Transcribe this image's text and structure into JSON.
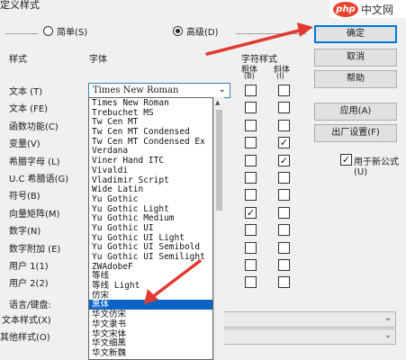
{
  "window": {
    "title": "定义样式"
  },
  "mode": {
    "simple_label": "简单(S)",
    "advanced_label": "高级(D)",
    "selected": "advanced"
  },
  "headers": {
    "style": "样式",
    "font": "字体",
    "char_format": "字符样式",
    "bold": "粗体",
    "bold_key": "(B)",
    "italic": "斜体",
    "italic_key": "(I)"
  },
  "font_select": {
    "value": "Times New Roman"
  },
  "rows": [
    {
      "label": "文本 (T)",
      "bold": false,
      "italic": false
    },
    {
      "label": "文本 (FE)",
      "bold": false,
      "italic": false
    },
    {
      "label": "函数功能(C)",
      "bold": false,
      "italic": false
    },
    {
      "label": "变量(V)",
      "bold": false,
      "italic": true
    },
    {
      "label": "希腊字母 (L)",
      "bold": false,
      "italic": true
    },
    {
      "label": "U.C 希腊语(G)",
      "bold": false,
      "italic": false
    },
    {
      "label": "符号(B)",
      "bold": false,
      "italic": false
    },
    {
      "label": "向量矩阵(M)",
      "bold": true,
      "italic": false
    },
    {
      "label": "数字(N)",
      "bold": false,
      "italic": false
    },
    {
      "label": "数字附加 (E)",
      "bold": false,
      "italic": false
    },
    {
      "label": "用户 1(1)",
      "bold": false,
      "italic": false
    },
    {
      "label": "用户 2(2)",
      "bold": false,
      "italic": false
    }
  ],
  "font_options": [
    "Times New Roman",
    "Trebuchet MS",
    "Tw Cen MT",
    "Tw Cen MT Condensed",
    "Tw Cen MT Condensed Ex",
    "Verdana",
    "Viner Hand ITC",
    "Vivaldi",
    "Vladimir Script",
    "Wide Latin",
    "Yu Gothic",
    "Yu Gothic Light",
    "Yu Gothic Medium",
    "Yu Gothic UI",
    "Yu Gothic UI Light",
    "Yu Gothic UI Semibold",
    "Yu Gothic UI Semilight",
    "ZWAdobeF",
    "等线",
    "等线 Light",
    "仿宋",
    "黑体",
    "华文仿宋",
    "华文隶书",
    "华文宋体",
    "华文细黑",
    "华文新魏"
  ],
  "selected_option_index": 21,
  "buttons": {
    "ok": "确定",
    "cancel": "取消",
    "help": "帮助",
    "apply": "应用(A)",
    "factory": "出厂设置(F)"
  },
  "new_formula": {
    "label": "用于新公式(U)",
    "checked": true
  },
  "bottom": {
    "lang_label": "语言/键盘:",
    "text_style_label": "文本样式(X)",
    "other_style_label": "其他样式(O)"
  },
  "logo": {
    "brand": "php",
    "text": "中文网"
  },
  "colors": {
    "accent": "#0078d7",
    "selection": "#0a64c8",
    "arrow": "#e23a33"
  }
}
